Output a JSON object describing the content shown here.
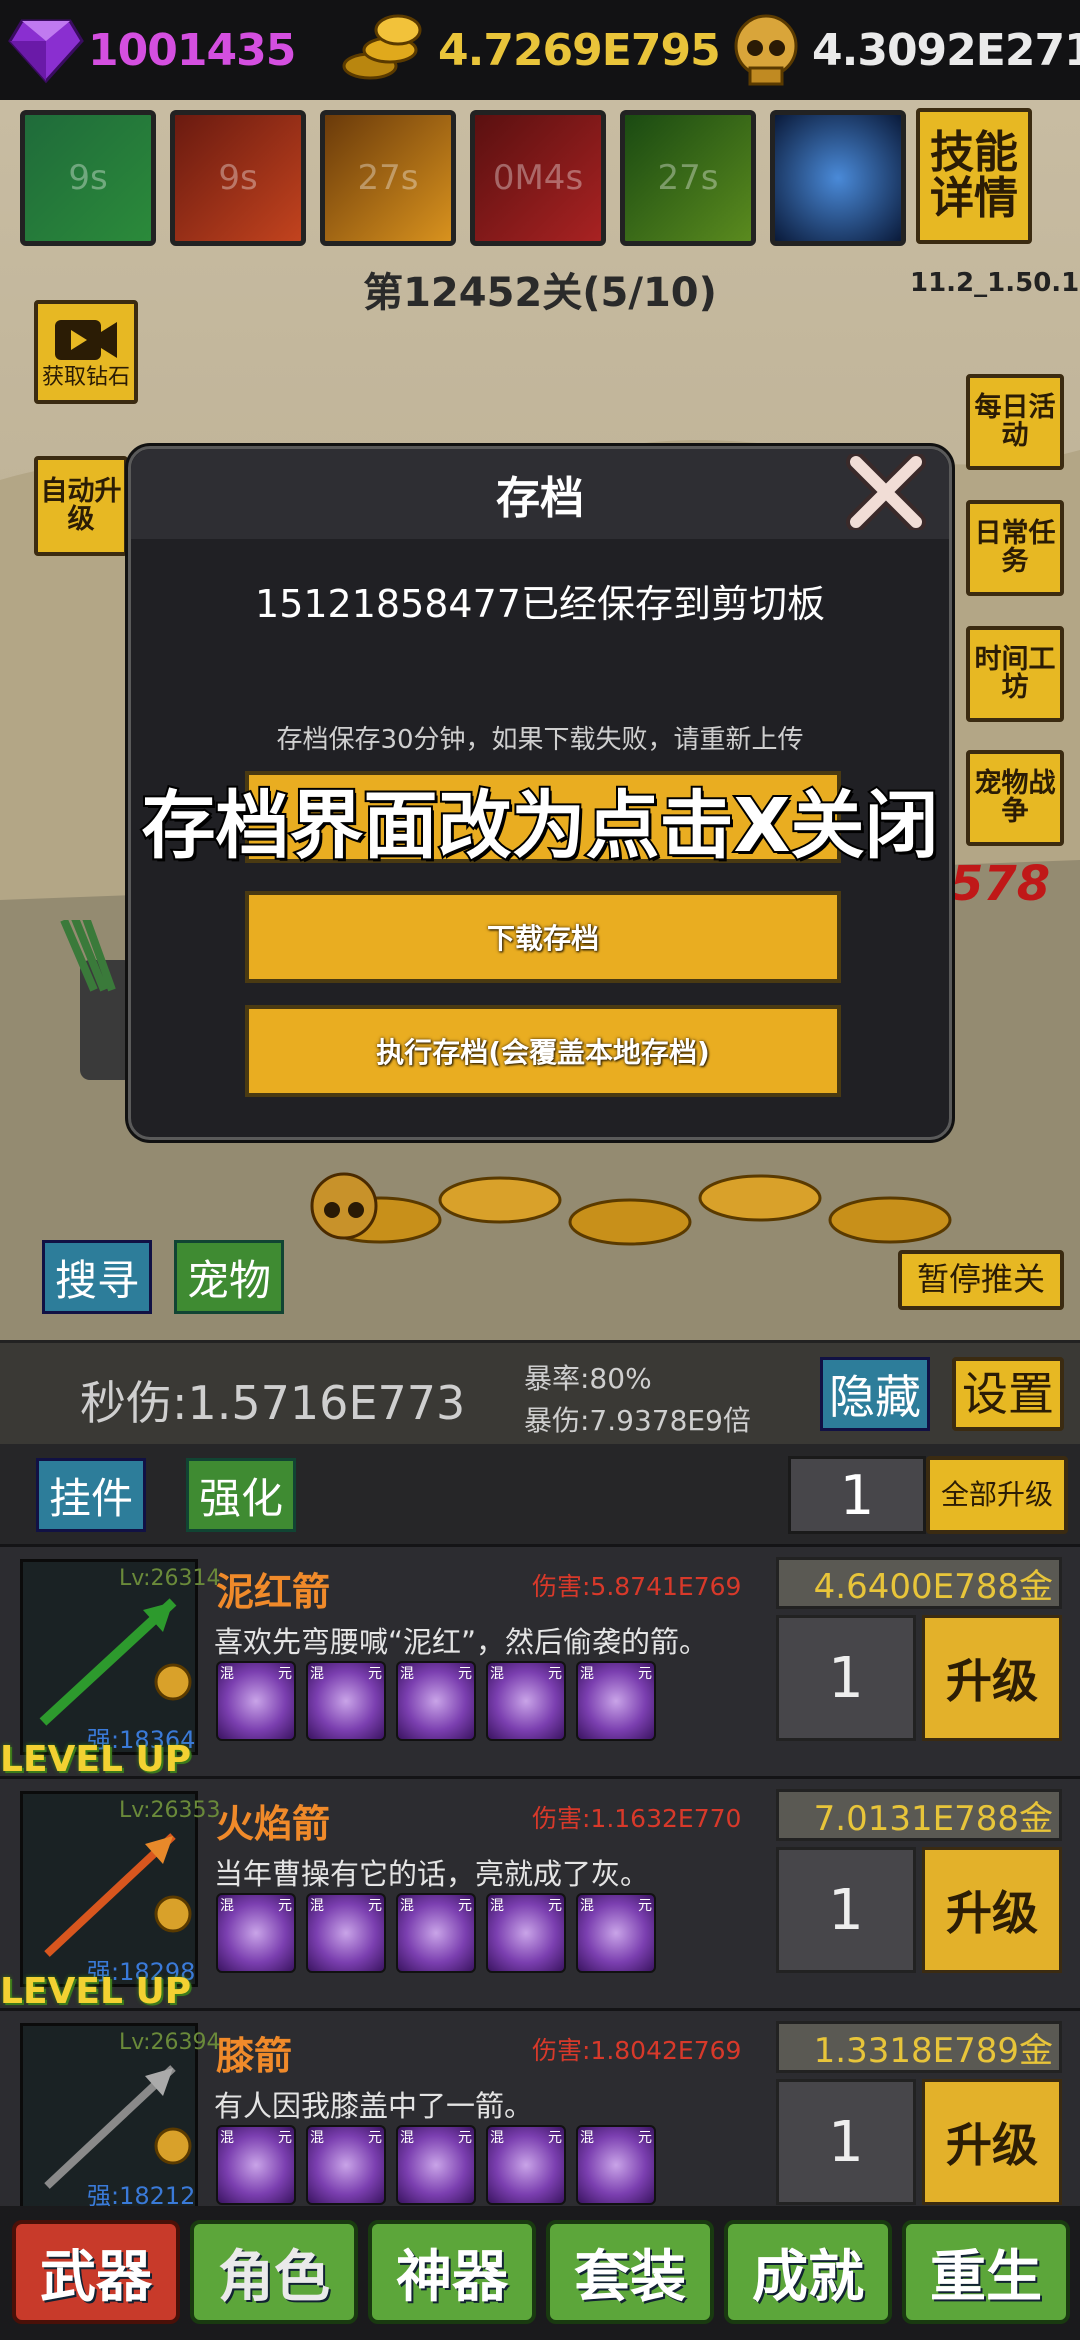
{
  "resources": {
    "diamonds": "1001435",
    "gold": "4.7269E795",
    "skulls": "4.3092E271"
  },
  "skills": [
    "9s",
    "9s",
    "27s",
    "0M4s",
    "27s",
    ""
  ],
  "skill_details_label": "技能详情",
  "stage_label": "第12452关(5/10)",
  "version": "11.2_1.50.1",
  "get_diamonds_label": "获取钻石",
  "auto_upgrade_label": "自动升级",
  "side_buttons": [
    "每日活动",
    "日常任务",
    "时间工坊",
    "宠物战争"
  ],
  "modal": {
    "title": "存档",
    "copied_message": "15121858477已经保存到剪切板",
    "hint": "存档保存30分钟，如果下载失败，请重新上传",
    "buttons": [
      "下载存档",
      "执行存档(会覆盖本地存档)"
    ]
  },
  "overlay_caption": "存档界面改为点击X关闭",
  "battle_buttons": {
    "search": "搜寻",
    "pet": "宠物",
    "pause": "暂停推关"
  },
  "floating_damage": "578",
  "stats": {
    "dps": "秒伤:1.5716E773",
    "crit_rate": "暴率:80%",
    "crit_damage": "暴伤:7.9378E9倍",
    "hide": "隐藏",
    "settings": "设置"
  },
  "tabs": {
    "hang": "挂件",
    "enhance": "强化",
    "quantity": "1",
    "upgrade_all": "全部升级"
  },
  "weapons": [
    {
      "name": "泥红箭",
      "level": "Lv:26314",
      "strength": "强:18364",
      "damage": "伤害:5.8741E769",
      "desc": "喜欢先弯腰喊“泥红”，然后偷袭的箭。",
      "price": "4.6400E788金",
      "qty": "1",
      "upgrade": "升级",
      "level_up": "LEVEL UP"
    },
    {
      "name": "火焰箭",
      "level": "Lv:26353",
      "strength": "强:18298",
      "damage": "伤害:1.1632E770",
      "desc": "当年曹操有它的话，亮就成了灰。",
      "price": "7.0131E788金",
      "qty": "1",
      "upgrade": "升级",
      "level_up": "LEVEL UP"
    },
    {
      "name": "膝箭",
      "level": "Lv:26394",
      "strength": "强:18212",
      "damage": "伤害:1.8042E769",
      "desc": "有人因我膝盖中了一箭。",
      "price": "1.3318E789金",
      "qty": "1",
      "upgrade": "升级",
      "level_up": ""
    }
  ],
  "gem_labels": [
    "混",
    "元"
  ],
  "nav": [
    "武器",
    "角色",
    "神器",
    "套装",
    "成就",
    "重生"
  ]
}
